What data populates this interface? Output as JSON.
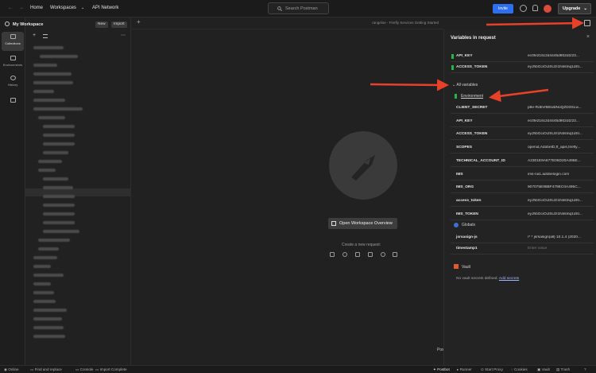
{
  "topbar": {
    "home": "Home",
    "workspaces": "Workspaces",
    "api_network": "API Network",
    "search_placeholder": "Search Postman",
    "invite": "Invite",
    "upgrade": "Upgrade"
  },
  "rail": {
    "collections": "Collections",
    "environments": "Environments",
    "history": "History"
  },
  "sidebar": {
    "workspace_title": "My Workspace",
    "new_label": "New",
    "import_label": "Import"
  },
  "main": {
    "env_label": "rangeloe - Firefly Services Getting Started",
    "open_overview": "Open Workspace Overview",
    "create_request": "Create a new request:"
  },
  "panel": {
    "title": "Variables in request",
    "top_vars": [
      {
        "name": "API_KEY",
        "value": "ec0fe216c2d4445d902d1f23..."
      },
      {
        "name": "ACCESS_TOKEN",
        "value": "eyJhbGciOiJSUzI1NiIsInq1dSl..."
      }
    ],
    "all_variables": "All variables",
    "environment": "Environment",
    "env_vars": [
      {
        "name": "CLIENT_SECRET",
        "value": "p8e-RdbVrBEwbNoQZD3SLw..."
      },
      {
        "name": "API_KEY",
        "value": "ec0fe216c2d4445d902d1f23..."
      },
      {
        "name": "ACCESS_TOKEN",
        "value": "eyJhbGciOiJSUzI1NiIsInq1dSl..."
      },
      {
        "name": "SCOPES",
        "value": "openid,AdobeID,ff_apis,firefly..."
      },
      {
        "name": "TECHNICAL_ACCOUNT_ID",
        "value": "A2301E9A677E06D20A495E..."
      },
      {
        "name": "IMS",
        "value": "ims-na1.adobelogin.com"
      },
      {
        "name": "IMS_ORG",
        "value": "907075E95BF479EC0A495C..."
      },
      {
        "name": "access_token",
        "value": "eyJhbGciOiJSUzI1NiIsInq1dSl..."
      },
      {
        "name": "IMS_TOKEN",
        "value": "eyJhbGciOiJSUzI1NiIsInq1dSl..."
      }
    ],
    "globals": "Globals",
    "global_vars": [
      {
        "name": "jsrsasign-js",
        "value": "/* * jsrsasign(all) 10.1.4 (2020..."
      },
      {
        "name": "timestamp1",
        "value": "Enter value"
      }
    ],
    "vault": "Vault",
    "vault_msg": "No vault secrets defined.",
    "vault_link": "Add secrets"
  },
  "postbot_tip": "Postbot",
  "statusbar": {
    "online": "Online",
    "find_replace": "Find and replace",
    "console": "Console",
    "import_complete": "Import Complete",
    "postbot": "Postbot",
    "runner": "Runner",
    "start_proxy": "Start Proxy",
    "cookies": "Cookies",
    "vault": "Vault",
    "trash": "Trash"
  },
  "colors": {
    "accent": "#2d6ff0",
    "annotation_arrow": "#e8412a",
    "env_badge": "#2bb24c"
  }
}
